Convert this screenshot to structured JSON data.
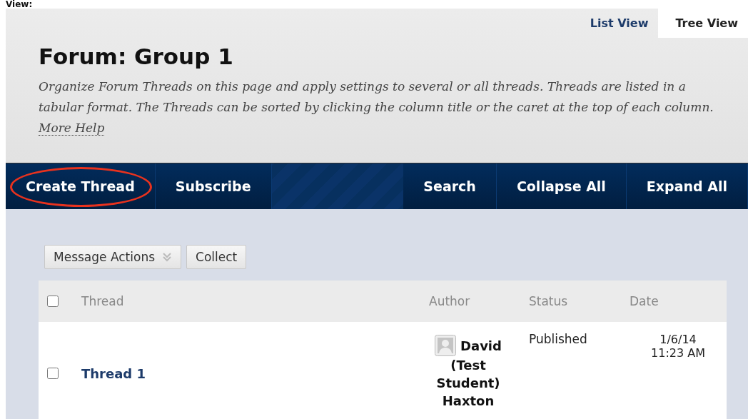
{
  "caption": "View:",
  "view_tabs": [
    {
      "label": "List View",
      "selected": false
    },
    {
      "label": "Tree View",
      "selected": true
    }
  ],
  "title": "Forum: Group 1",
  "description": "Organize Forum Threads on this page and apply settings to several or all threads. Threads are listed in a tabular format. The Threads can be sorted by clicking the column title or the caret at the top of each column.",
  "help_link": "More Help",
  "action_bar": {
    "left": [
      {
        "label": "Create Thread",
        "highlighted": true
      },
      {
        "label": "Subscribe",
        "highlighted": false
      }
    ],
    "right": [
      {
        "label": "Search",
        "highlighted": false
      },
      {
        "label": "Collapse All",
        "highlighted": false
      },
      {
        "label": "Expand All",
        "highlighted": false
      }
    ]
  },
  "toolbar": {
    "menu": "Message Actions",
    "button": "Collect"
  },
  "table": {
    "select_all_checked": false,
    "columns": [
      "Thread",
      "Author",
      "Status",
      "Date"
    ],
    "rows": [
      {
        "checked": false,
        "thread": "Thread 1",
        "author": [
          "David",
          "(Test",
          "Student)",
          "Haxton"
        ],
        "status": "Published",
        "date": [
          "1/6/14",
          "11:23 AM"
        ]
      }
    ]
  }
}
